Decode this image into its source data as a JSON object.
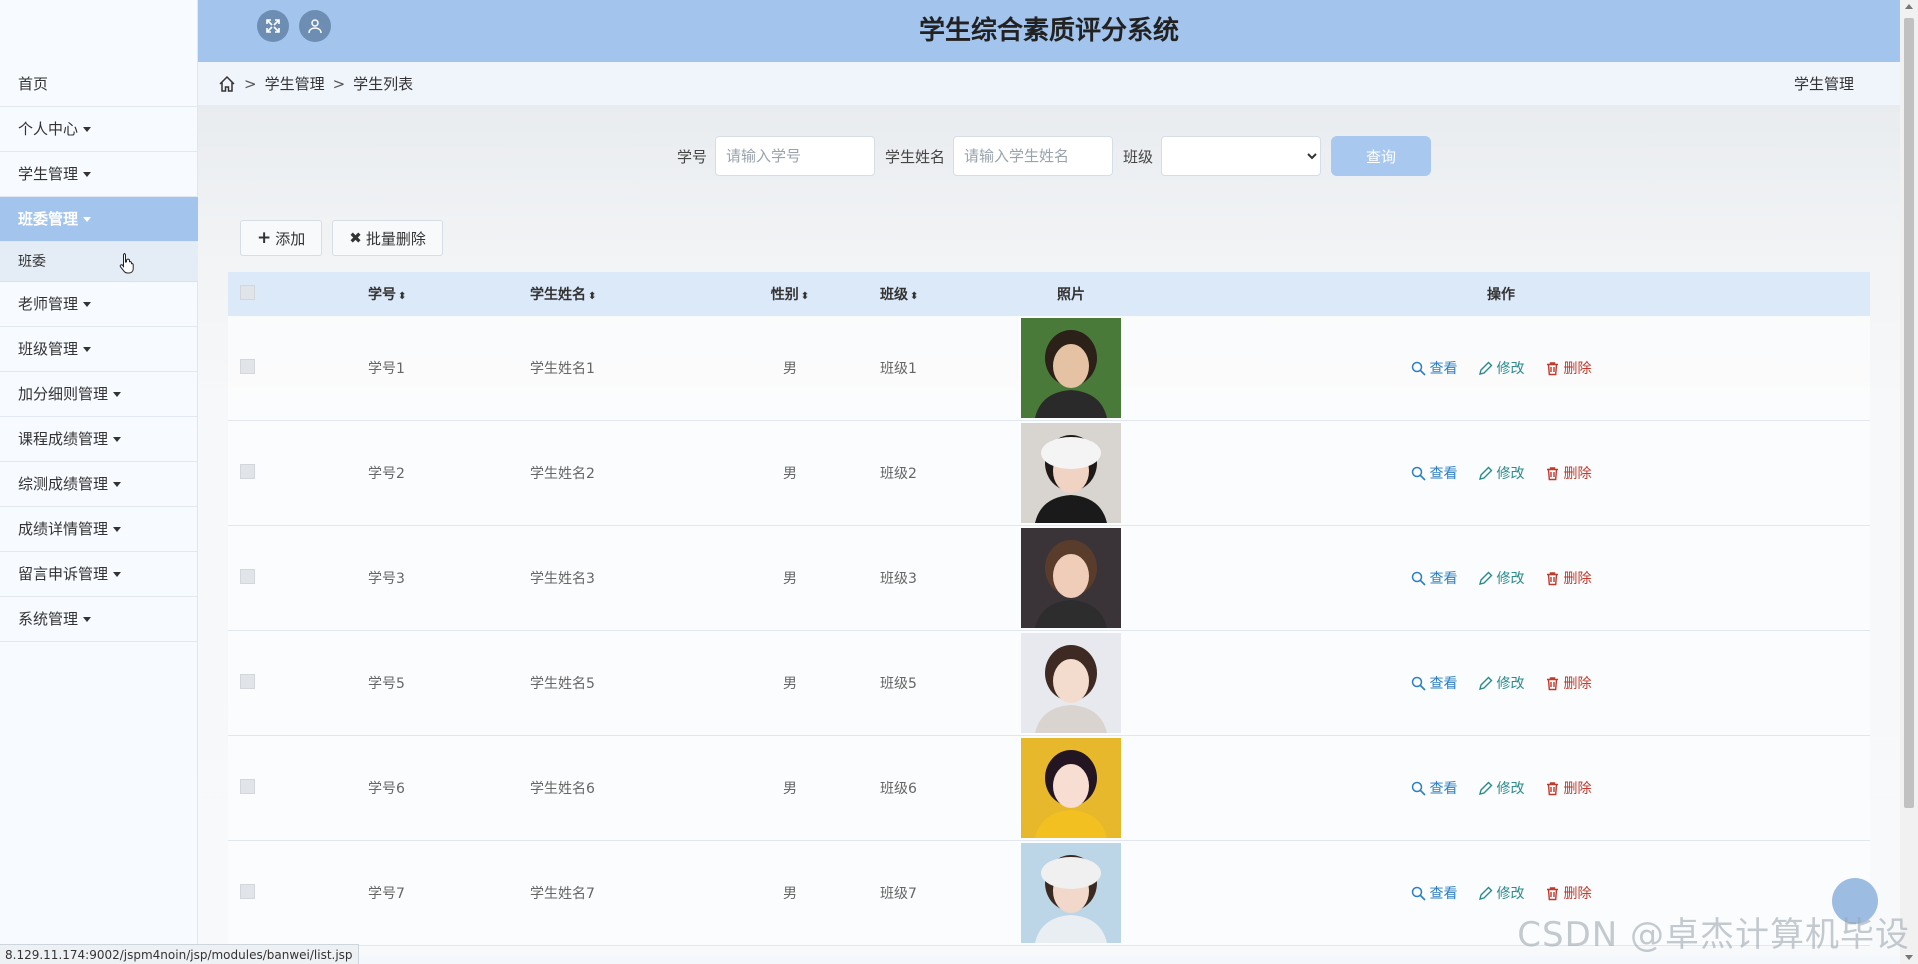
{
  "app": {
    "title": "学生综合素质评分系统"
  },
  "sidebar": {
    "items": [
      {
        "label": "首页",
        "has_caret": false,
        "active": false
      },
      {
        "label": "个人中心",
        "has_caret": true,
        "active": false
      },
      {
        "label": "学生管理",
        "has_caret": true,
        "active": false
      },
      {
        "label": "班委管理",
        "has_caret": true,
        "active": true
      },
      {
        "label": "老师管理",
        "has_caret": true,
        "active": false
      },
      {
        "label": "班级管理",
        "has_caret": true,
        "active": false
      },
      {
        "label": "加分细则管理",
        "has_caret": true,
        "active": false
      },
      {
        "label": "课程成绩管理",
        "has_caret": true,
        "active": false
      },
      {
        "label": "综测成绩管理",
        "has_caret": true,
        "active": false
      },
      {
        "label": "成绩详情管理",
        "has_caret": true,
        "active": false
      },
      {
        "label": "留言申诉管理",
        "has_caret": true,
        "active": false
      },
      {
        "label": "系统管理",
        "has_caret": true,
        "active": false
      }
    ],
    "submenu": {
      "label": "班委"
    }
  },
  "breadcrumb": {
    "items": [
      "学生管理",
      "学生列表"
    ],
    "sep": ">",
    "right_label": "学生管理"
  },
  "search": {
    "student_no_label": "学号",
    "student_no_placeholder": "请输入学号",
    "student_name_label": "学生姓名",
    "student_name_placeholder": "请输入学生姓名",
    "class_label": "班级",
    "class_value": "",
    "submit_label": "查询"
  },
  "actions": {
    "add_label": "添加",
    "batch_delete_label": "批量删除"
  },
  "table": {
    "headers": {
      "no": "学号",
      "name": "学生姓名",
      "sex": "性别",
      "cls": "班级",
      "photo": "照片",
      "ops": "操作"
    },
    "op_labels": {
      "view": "查看",
      "edit": "修改",
      "del": "删除"
    },
    "rows": [
      {
        "no": "学号1",
        "name": "学生姓名1",
        "sex": "男",
        "cls": "班级1"
      },
      {
        "no": "学号2",
        "name": "学生姓名2",
        "sex": "男",
        "cls": "班级2"
      },
      {
        "no": "学号3",
        "name": "学生姓名3",
        "sex": "男",
        "cls": "班级3"
      },
      {
        "no": "学号5",
        "name": "学生姓名5",
        "sex": "男",
        "cls": "班级5"
      },
      {
        "no": "学号6",
        "name": "学生姓名6",
        "sex": "男",
        "cls": "班级6"
      },
      {
        "no": "学号7",
        "name": "学生姓名7",
        "sex": "男",
        "cls": "班级7"
      }
    ]
  },
  "status_url": "8.129.11.174:9002/jspm4noin/jsp/modules/banwei/list.jsp",
  "watermark": "CSDN @卓杰计算机毕设",
  "colors": {
    "header_bg": "#a2c4ed",
    "active_menu": "#a2c4ed",
    "view": "#2b7fc3",
    "edit": "#2b8a8a",
    "delete": "#c0392b"
  }
}
